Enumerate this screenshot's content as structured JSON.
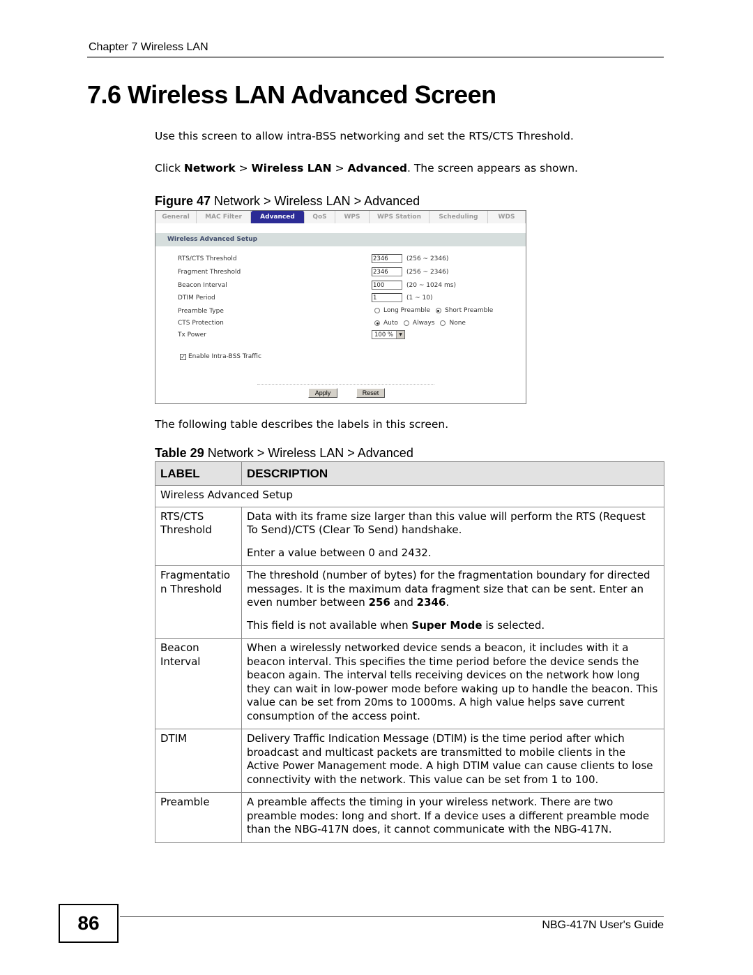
{
  "header": {
    "chapter": "Chapter 7 Wireless LAN"
  },
  "section_title": "7.6  Wireless LAN Advanced Screen",
  "intro": "Use this screen to allow intra-BSS networking and set the  RTS/CTS Threshold.",
  "click_path": {
    "prefix": "Click ",
    "step1": "Network",
    "sep": " > ",
    "step2": "Wireless LAN",
    "step3": "Advanced",
    "suffix": ". The screen appears as shown."
  },
  "figure": {
    "label": "Figure 47",
    "caption": "  Network > Wireless LAN > Advanced",
    "tabs": [
      {
        "label": "General",
        "active": false
      },
      {
        "label": "MAC Filter",
        "active": false
      },
      {
        "label": "Advanced",
        "active": true
      },
      {
        "label": "QoS",
        "active": false
      },
      {
        "label": "WPS",
        "active": false
      },
      {
        "label": "WPS Station",
        "active": false
      },
      {
        "label": "Scheduling",
        "active": false
      },
      {
        "label": "WDS",
        "active": false
      }
    ],
    "section_heading": "Wireless Advanced Setup",
    "fields": {
      "rts": {
        "label": "RTS/CTS Threshold",
        "value": "2346",
        "range": "(256 ~ 2346)"
      },
      "frag": {
        "label": "Fragment Threshold",
        "value": "2346",
        "range": "(256 ~ 2346)"
      },
      "beacon": {
        "label": "Beacon Interval",
        "value": "100",
        "range": "(20 ~ 1024 ms)"
      },
      "dtim": {
        "label": "DTIM Period",
        "value": "1",
        "range": "(1 ~ 10)"
      },
      "preamble": {
        "label": "Preamble Type",
        "options": [
          "Long Preamble",
          "Short Preamble"
        ],
        "selected": "Short Preamble"
      },
      "cts": {
        "label": "CTS Protection",
        "options": [
          "Auto",
          "Always",
          "None"
        ],
        "selected": "Auto"
      },
      "txpower": {
        "label": "Tx Power",
        "value": "100 %"
      },
      "intrabss": {
        "label": "Enable Intra-BSS Traffic",
        "checked": true
      }
    },
    "buttons": {
      "apply": "Apply",
      "reset": "Reset"
    }
  },
  "following_text": "The following table describes the labels in this screen.",
  "table": {
    "label": "Table 29",
    "caption": "  Network > Wireless LAN > Advanced",
    "headers": [
      "LABEL",
      "DESCRIPTION"
    ],
    "section_row": "Wireless Advanced Setup",
    "rows": [
      {
        "label": "RTS/CTS Threshold",
        "p1": "Data with its frame size larger than this value will perform the RTS (Request To Send)/CTS (Clear To Send) handshake.",
        "p2": "Enter a value between 0 and 2432."
      },
      {
        "label": "Fragmentatio n Threshold",
        "p1_a": "The threshold (number of bytes) for the fragmentation boundary for directed messages. It is the maximum data fragment size that can be sent. Enter an even number between ",
        "p1_b": "256",
        "p1_c": " and ",
        "p1_d": "2346",
        "p1_e": ".",
        "p2_a": "This field is not available when ",
        "p2_b": "Super Mode",
        "p2_c": " is selected."
      },
      {
        "label": "Beacon Interval",
        "p1": "When a wirelessly networked device sends a beacon, it includes with it a beacon interval. This specifies the time period before the device sends the beacon again. The interval tells receiving devices on the network how long they can wait in low-power mode before waking up to handle the beacon. This value can be set from 20ms to 1000ms. A high value helps save current consumption of the access point."
      },
      {
        "label": "DTIM",
        "p1": "Delivery Traffic Indication Message (DTIM) is the time period after which broadcast and multicast packets are transmitted to mobile clients in the Active Power Management mode. A high DTIM value can cause clients to lose connectivity with the network. This value can be set from 1 to 100."
      },
      {
        "label": "Preamble",
        "p1": "A preamble affects the timing in your wireless network. There are two preamble modes: long and short. If a device uses a different preamble mode than the NBG-417N does, it cannot communicate with the NBG-417N."
      }
    ]
  },
  "footer": {
    "page_number": "86",
    "guide": "NBG-417N User's Guide"
  }
}
